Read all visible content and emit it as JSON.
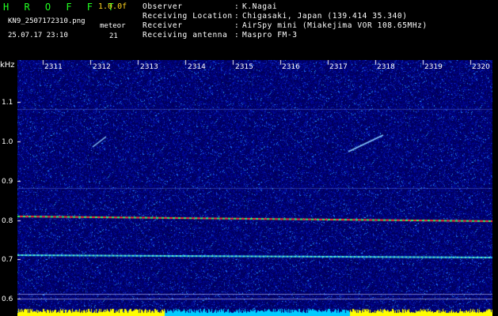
{
  "header": {
    "app_title": "H R O F F T",
    "version": "1.0.0f",
    "filename": "KN9_2507172310.png",
    "mode": "meteor",
    "datetime": "25.07.17 23:10",
    "count": "21"
  },
  "info": [
    {
      "label": "Observer",
      "value": "K.Nagai"
    },
    {
      "label": "Receiving Location",
      "value": "Chigasaki, Japan (139.414 35.340)"
    },
    {
      "label": "Receiver",
      "value": "AirSpy mini (Miakejima VOR 108.65MHz)"
    },
    {
      "label": "Receiving antenna",
      "value": "Maspro FM-3"
    }
  ],
  "spectrogram": {
    "unit": "kHz",
    "y_ticks": [
      "1.1",
      "1.0",
      "0.9",
      "0.8",
      "0.7",
      "0.6"
    ],
    "x_ticks": [
      "2311",
      "2312",
      "2313",
      "2314",
      "2315",
      "2316",
      "2317",
      "2318",
      "2319",
      "2320"
    ],
    "colors": {
      "background": "#00007a",
      "carrier": "#ff3333",
      "baseline": "#ffff00",
      "lowband": "#00ccff"
    }
  }
}
